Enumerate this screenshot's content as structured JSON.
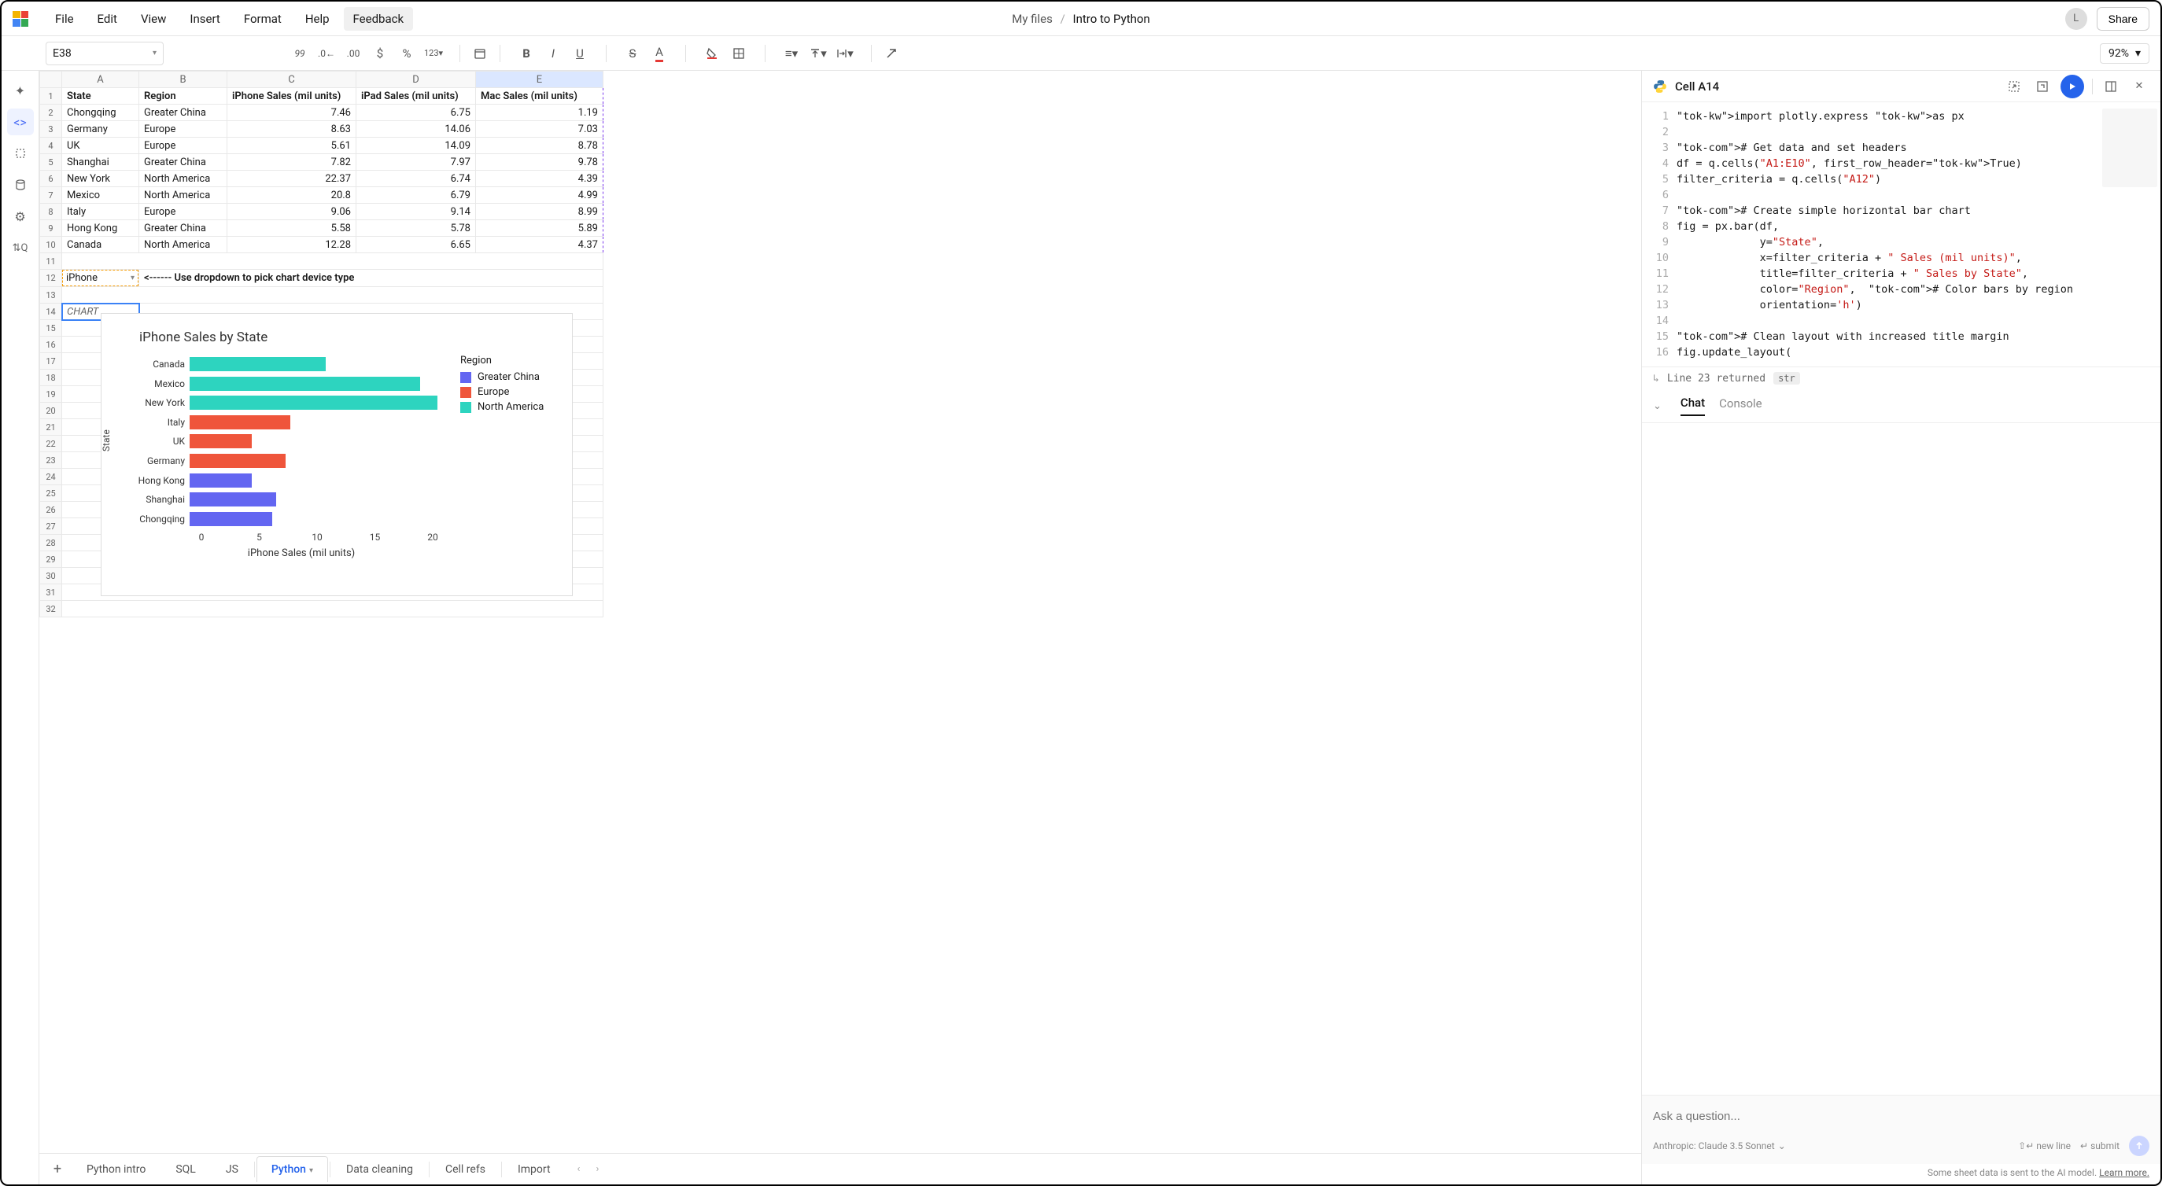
{
  "menu": {
    "items": [
      "File",
      "Edit",
      "View",
      "Insert",
      "Format",
      "Help",
      "Feedback"
    ]
  },
  "breadcrumb": {
    "parent": "My files",
    "current": "Intro to Python"
  },
  "user": {
    "initial": "L",
    "share": "Share"
  },
  "toolbar": {
    "cellref": "E38",
    "zoom": "92%"
  },
  "columns": [
    "A",
    "B",
    "C",
    "D",
    "E"
  ],
  "headers": [
    "State",
    "Region",
    "iPhone Sales (mil units)",
    "iPad Sales (mil units)",
    "Mac Sales (mil units)"
  ],
  "rows": [
    [
      "Chongqing",
      "Greater China",
      "7.46",
      "6.75",
      "1.19"
    ],
    [
      "Germany",
      "Europe",
      "8.63",
      "14.06",
      "7.03"
    ],
    [
      "UK",
      "Europe",
      "5.61",
      "14.09",
      "8.78"
    ],
    [
      "Shanghai",
      "Greater China",
      "7.82",
      "7.97",
      "9.78"
    ],
    [
      "New York",
      "North America",
      "22.37",
      "6.74",
      "4.39"
    ],
    [
      "Mexico",
      "North America",
      "20.8",
      "6.79",
      "4.99"
    ],
    [
      "Italy",
      "Europe",
      "9.06",
      "9.14",
      "8.99"
    ],
    [
      "Hong Kong",
      "Greater China",
      "5.58",
      "5.78",
      "5.89"
    ],
    [
      "Canada",
      "North America",
      "12.28",
      "6.65",
      "4.37"
    ]
  ],
  "dropdown": {
    "value": "iPhone",
    "hint": "<------ Use dropdown to pick chart device type"
  },
  "chart_cell": "CHART",
  "chart_data": {
    "type": "bar",
    "orientation": "h",
    "title": "iPhone Sales by State",
    "xlabel": "iPhone Sales (mil units)",
    "ylabel": "State",
    "xlim": [
      0,
      23
    ],
    "xticks": [
      0,
      5,
      10,
      15,
      20
    ],
    "legend_title": "Region",
    "series_field": "Region",
    "categories": [
      "Canada",
      "Mexico",
      "New York",
      "Italy",
      "UK",
      "Germany",
      "Hong Kong",
      "Shanghai",
      "Chongqing"
    ],
    "values": [
      12.28,
      20.8,
      22.37,
      9.06,
      5.61,
      8.63,
      5.58,
      7.82,
      7.46
    ],
    "region": [
      "North America",
      "North America",
      "North America",
      "Europe",
      "Europe",
      "Europe",
      "Greater China",
      "Greater China",
      "Greater China"
    ],
    "legend": [
      "Greater China",
      "Europe",
      "North America"
    ],
    "colors": {
      "Greater China": "#6366f1",
      "Europe": "#ef553b",
      "North America": "#2dd4bf"
    }
  },
  "right_panel": {
    "title": "Cell A14",
    "code_lines": [
      "import plotly.express as px",
      "",
      "# Get data and set headers",
      "df = q.cells(\"A1:E10\", first_row_header=True)",
      "filter_criteria = q.cells(\"A12\")",
      "",
      "# Create simple horizontal bar chart",
      "fig = px.bar(df,",
      "             y=\"State\",",
      "             x=filter_criteria + \" Sales (mil units)\",",
      "             title=filter_criteria + \" Sales by State\",",
      "             color=\"Region\",  # Color bars by region",
      "             orientation='h')",
      "",
      "# Clean layout with increased title margin",
      "fig.update_layout("
    ],
    "return_text": "Line 23 returned",
    "return_type": "str",
    "tabs": [
      "Chat",
      "Console"
    ],
    "active_tab": "Chat",
    "chat_placeholder": "Ask a question...",
    "model": "Anthropic: Claude 3.5 Sonnet",
    "hint_newline": "new line",
    "hint_submit": "submit",
    "privacy": "Some sheet data is sent to the AI model.",
    "privacy_link": "Learn more."
  },
  "sheet_tabs": [
    "Python intro",
    "SQL",
    "JS",
    "Python",
    "Data cleaning",
    "Cell refs",
    "Import"
  ],
  "active_sheet_tab": "Python"
}
